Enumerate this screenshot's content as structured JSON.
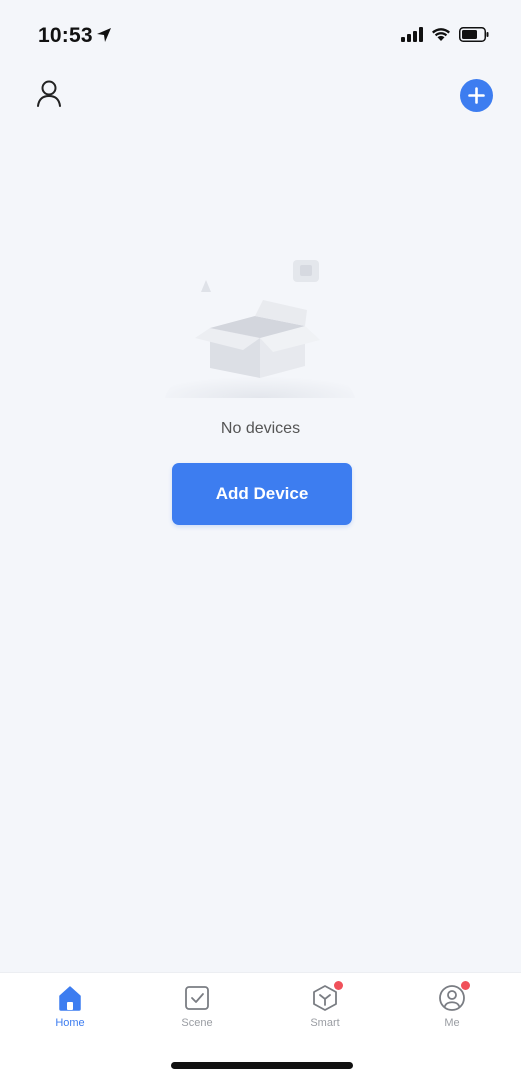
{
  "status_bar": {
    "time": "10:53"
  },
  "empty_state": {
    "message": "No devices",
    "button_label": "Add Device"
  },
  "tabs": [
    {
      "label": "Home",
      "icon": "home-icon",
      "active": true
    },
    {
      "label": "Scene",
      "icon": "scene-icon",
      "active": false
    },
    {
      "label": "Smart",
      "icon": "smart-icon",
      "active": false
    },
    {
      "label": "Me",
      "icon": "me-icon",
      "active": false
    }
  ],
  "colors": {
    "accent": "#3d7df0",
    "background": "#f4f6fa",
    "badge": "#f0515a",
    "inactive_label": "#9a9da3"
  }
}
